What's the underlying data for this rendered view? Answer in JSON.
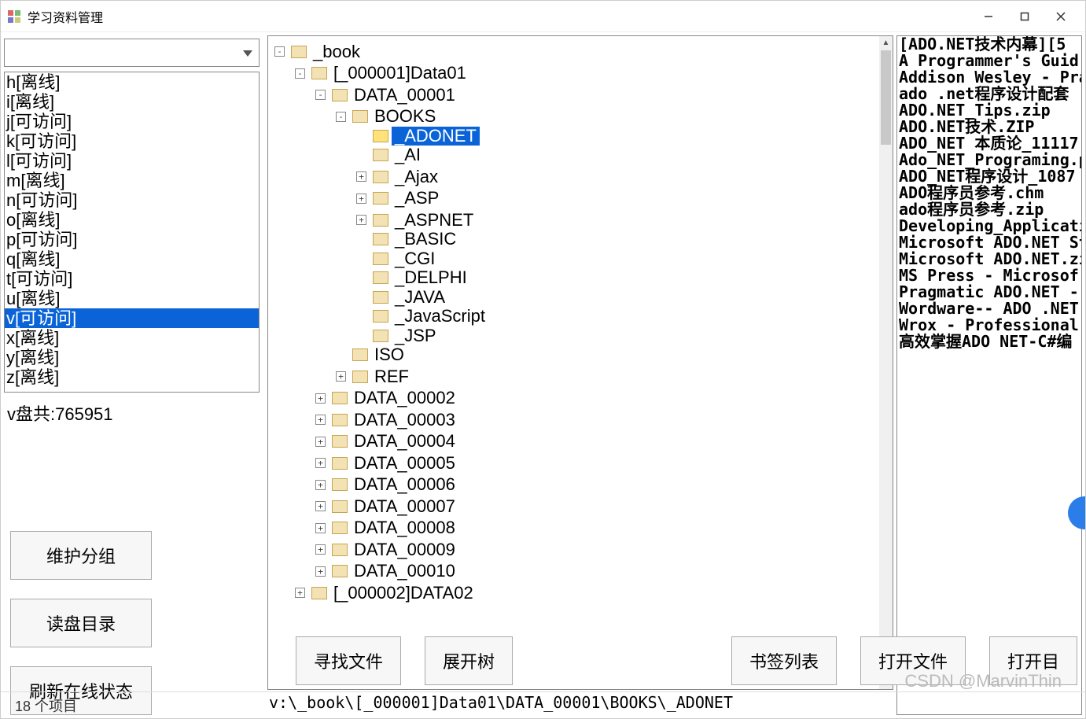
{
  "window": {
    "title": "学习资料管理"
  },
  "drives": [
    {
      "label": "h[离线]"
    },
    {
      "label": "i[离线]"
    },
    {
      "label": "j[可访问]"
    },
    {
      "label": "k[可访问]"
    },
    {
      "label": "l[可访问]"
    },
    {
      "label": "m[离线]"
    },
    {
      "label": "n[可访问]"
    },
    {
      "label": "o[离线]"
    },
    {
      "label": "p[可访问]"
    },
    {
      "label": "q[离线]"
    },
    {
      "label": "t[可访问]"
    },
    {
      "label": "u[离线]"
    },
    {
      "label": "v[可访问]",
      "selected": true
    },
    {
      "label": "x[离线]"
    },
    {
      "label": "y[离线]"
    },
    {
      "label": "z[离线]"
    }
  ],
  "disk_info": "v盘共:765951",
  "left_buttons": {
    "maintain_group": "维护分组",
    "read_dir": "读盘目录",
    "refresh_status": "刷新在线状态"
  },
  "tree": {
    "root": "_book",
    "n1": "[_000001]Data01",
    "n2": "DATA_00001",
    "n3": "BOOKS",
    "books": {
      "adonet": "_ADONET",
      "ai": "_AI",
      "ajax": "_Ajax",
      "asp": "_ASP",
      "aspnet": "_ASPNET",
      "basic": "_BASIC",
      "cgi": "_CGI",
      "delphi": "_DELPHI",
      "java": "_JAVA",
      "javascript": "_JavaScript",
      "jsp": "_JSP"
    },
    "iso": "ISO",
    "ref": "REF",
    "d2": "DATA_00002",
    "d3": "DATA_00003",
    "d4": "DATA_00004",
    "d5": "DATA_00005",
    "d6": "DATA_00006",
    "d7": "DATA_00007",
    "d8": "DATA_00008",
    "d9": "DATA_00009",
    "d10": "DATA_00010",
    "n_next": "[_000002]DATA02"
  },
  "path": "v:\\_book\\[_000001]Data01\\DATA_00001\\BOOKS\\_ADONET",
  "files": [
    "[ADO.NET技术内幕][5",
    "A Programmer's Guid",
    "Addison Wesley - Pra",
    "ado .net程序设计配套",
    "ADO.NET_Tips.zip",
    "ADO.NET技术.ZIP",
    "ADO_NET 本质论_11117",
    "Ado_NET_Programing.p",
    "ADO_NET程序设计_1087",
    "ADO程序员参考.chm",
    "ado程序员参考.zip",
    "Developing_Applicati",
    "Microsoft ADO.NET St",
    "Microsoft ADO.NET.zi",
    "MS Press - Microsof",
    "Pragmatic ADO.NET -",
    "Wordware-- ADO .NET",
    "Wrox - Professional",
    "高效掌握ADO NET-C#编"
  ],
  "bottom_buttons": {
    "find_file": "寻找文件",
    "expand_tree": "展开树",
    "bookmark_list": "书签列表",
    "open_file": "打开文件",
    "open_dir": "打开目"
  },
  "status": "18 个项目",
  "watermark": "CSDN @MarvinThin"
}
